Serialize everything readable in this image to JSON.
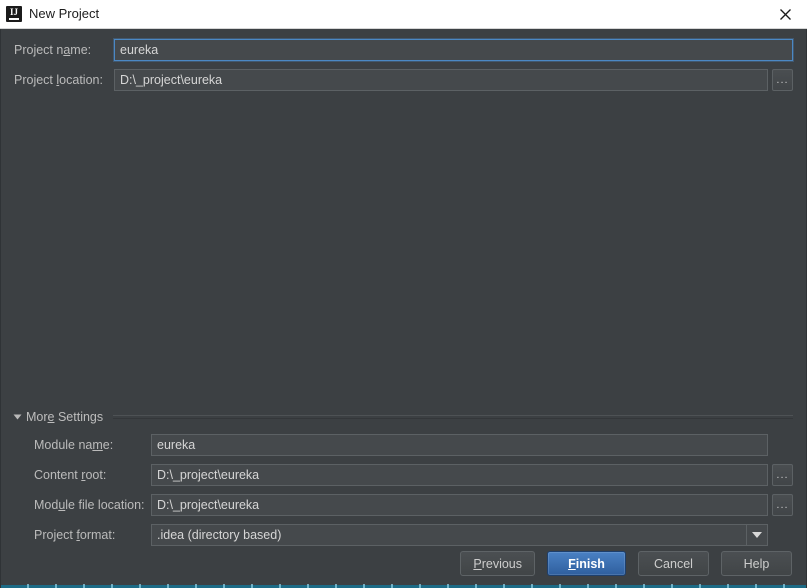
{
  "window": {
    "title": "New Project",
    "logo_icon": "intellij-idea-logo",
    "close_icon": "close-icon",
    "background_color": "#3c4043",
    "titlebar_color": "#ffffff"
  },
  "top_form": {
    "project_name": {
      "label_before": "Project n",
      "label_mnemonic": "a",
      "label_after": "me:",
      "value": "eureka",
      "focused": true
    },
    "project_location": {
      "label_before": "Project ",
      "label_mnemonic": "l",
      "label_after": "ocation:",
      "value": "D:\\_project\\eureka",
      "browse_label": "...",
      "focused": false
    }
  },
  "more_settings": {
    "label_before": "Mor",
    "label_mnemonic": "e",
    "label_after": " Settings",
    "expanded": true,
    "toggle_icon": "chevron-down-icon"
  },
  "bottom_form": {
    "module_name": {
      "label_before": "Module na",
      "label_mnemonic": "m",
      "label_after": "e:",
      "value": "eureka"
    },
    "content_root": {
      "label_before": "Content ",
      "label_mnemonic": "r",
      "label_after": "oot:",
      "value": "D:\\_project\\eureka",
      "browse_label": "..."
    },
    "module_file_location": {
      "label_before": "Mod",
      "label_mnemonic": "u",
      "label_after": "le file location:",
      "value": "D:\\_project\\eureka",
      "browse_label": "..."
    },
    "project_format": {
      "label_before": "Project ",
      "label_mnemonic": "f",
      "label_after": "ormat:",
      "value": ".idea (directory based)",
      "dropdown_icon": "chevron-down-icon"
    }
  },
  "footer": {
    "previous": {
      "before": "",
      "mnemonic": "P",
      "after": "revious"
    },
    "finish": {
      "before": "",
      "mnemonic": "F",
      "after": "inish",
      "is_default": true
    },
    "cancel": {
      "before": "Cancel",
      "mnemonic": "",
      "after": ""
    },
    "help": {
      "before": "Help",
      "mnemonic": "",
      "after": ""
    }
  }
}
